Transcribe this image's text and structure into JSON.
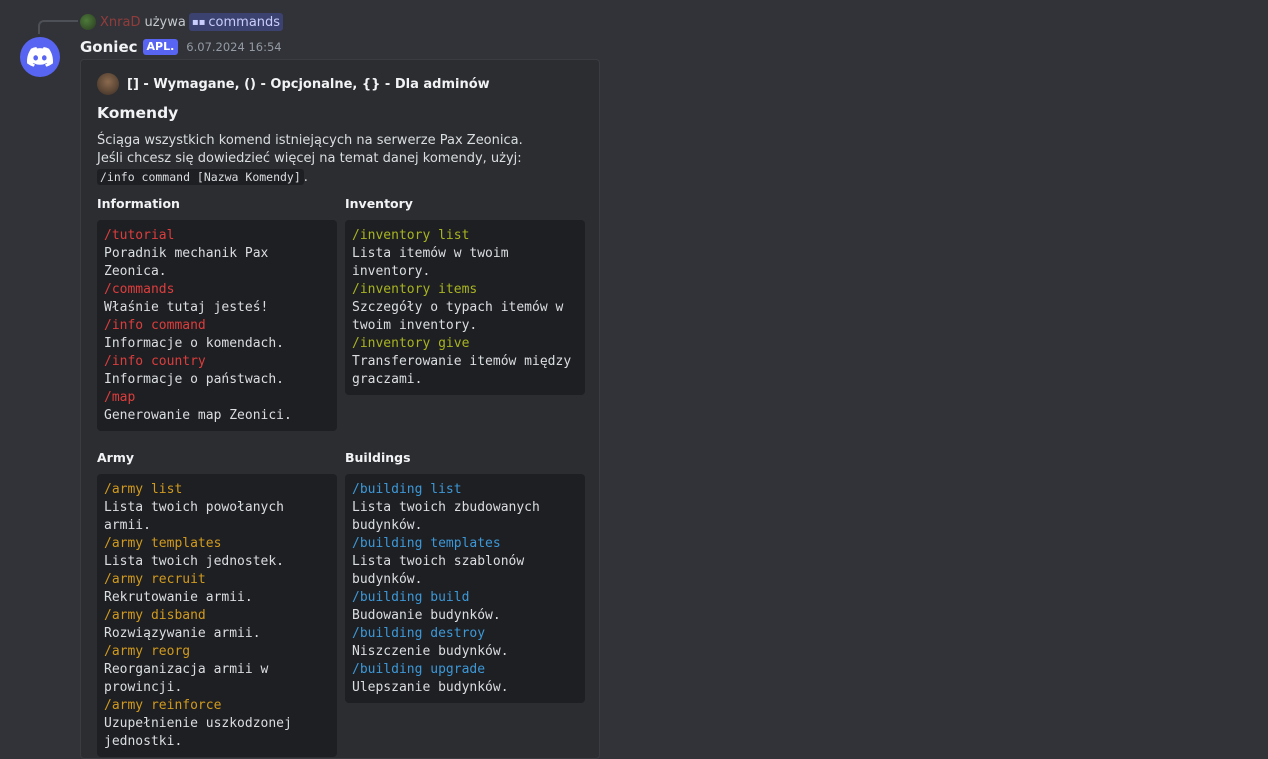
{
  "reply": {
    "username": "XnraD",
    "verb": "używa",
    "command": "commands"
  },
  "message": {
    "author": "Goniec",
    "badge": "APL.",
    "timestamp": "6.07.2024 16:54"
  },
  "embed": {
    "author": "[] - Wymagane, () - Opcjonalne, {} - Dla adminów",
    "title": "Komendy",
    "description_line1": "Ściąga wszystkich komend istniejących na serwerze Pax Zeonica.",
    "description_line2": "Jeśli chcesz się dowiedzieć więcej na temat danej komendy, użyj:",
    "description_code": "/info command [Nazwa Komendy]",
    "description_end": ".",
    "fields": [
      {
        "name": "Information",
        "lines": [
          {
            "cmd": "/tutorial"
          },
          {
            "text": "Poradnik mechanik Pax Zeonica."
          },
          {
            "cmd": "/commands"
          },
          {
            "text": "Właśnie tutaj jesteś!"
          },
          {
            "cmd": "/info command"
          },
          {
            "text": "Informacje o komendach."
          },
          {
            "cmd": "/info country"
          },
          {
            "text": "Informacje o państwach."
          },
          {
            "cmd": "/map"
          },
          {
            "text": "Generowanie map Zeonici."
          }
        ]
      },
      {
        "name": "Inventory",
        "lines": [
          {
            "cmd": "/inventory list"
          },
          {
            "text": "Lista itemów w twoim inventory."
          },
          {
            "cmd": "/inventory items"
          },
          {
            "text": "Szczegóły o typach itemów w twoim inventory."
          },
          {
            "cmd": "/inventory give"
          },
          {
            "text": "Transferowanie itemów między graczami."
          }
        ]
      },
      {
        "name": "Army",
        "lines": [
          {
            "cmd": "/army list"
          },
          {
            "text": "Lista twoich powołanych armii."
          },
          {
            "cmd": "/army templates"
          },
          {
            "text": "Lista twoich jednostek."
          },
          {
            "cmd": "/army recruit"
          },
          {
            "text": "Rekrutowanie armii."
          },
          {
            "cmd": "/army disband"
          },
          {
            "text": "Rozwiązywanie armii."
          },
          {
            "cmd": "/army reorg"
          },
          {
            "text": "Reorganizacja armii w prowincji."
          },
          {
            "cmd": "/army reinforce"
          },
          {
            "text": "Uzupełnienie uszkodzonej jednostki."
          }
        ]
      },
      {
        "name": "Buildings",
        "lines": [
          {
            "cmd": "/building list"
          },
          {
            "text": "Lista twoich zbudowanych budynków."
          },
          {
            "cmd": "/building templates"
          },
          {
            "text": "Lista twoich szablonów budynków."
          },
          {
            "cmd": "/building build"
          },
          {
            "text": "Budowanie budynków."
          },
          {
            "cmd": "/building destroy"
          },
          {
            "text": "Niszczenie budynków."
          },
          {
            "cmd": "/building upgrade"
          },
          {
            "text": "Ulepszanie budynków."
          }
        ]
      }
    ]
  },
  "colors": {
    "information": "#dc3d3d",
    "inventory": "#a8b420",
    "army": "#d19a1e",
    "buildings": "#3d98d8"
  },
  "icons": {
    "avatar": "discord-logo-icon",
    "command": "slash-command-icon"
  }
}
